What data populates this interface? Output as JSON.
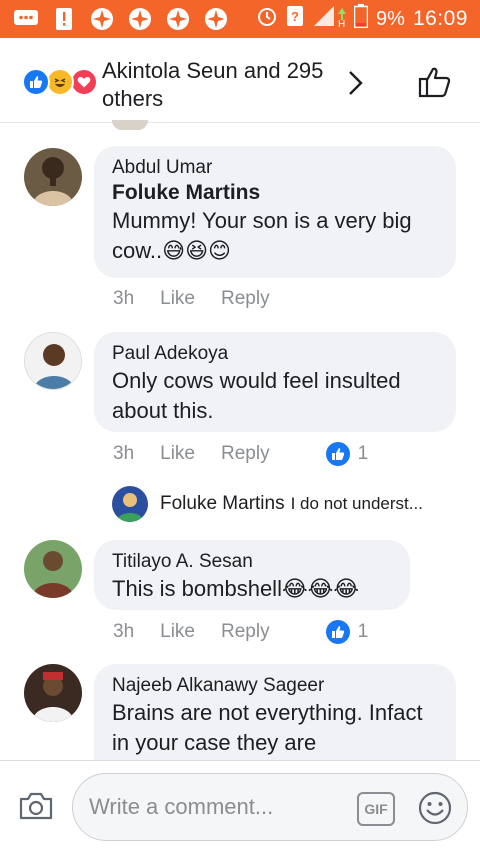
{
  "status_bar": {
    "battery": "9%",
    "time": "16:09",
    "network": "H"
  },
  "header": {
    "reactions_text": "Akintola Seun and 295 others",
    "reaction_icons": [
      "like-icon",
      "haha-icon",
      "love-icon"
    ]
  },
  "comments": [
    {
      "author": "Abdul Umar",
      "mention": "Foluke Martins",
      "text": "Mummy! Your son is a very big cow..",
      "emojis": "😅😆😊",
      "time": "3h",
      "like_label": "Like",
      "reply_label": "Reply",
      "likes": ""
    },
    {
      "author": "Paul Adekoya",
      "text": "Only cows would feel insulted about this.",
      "time": "3h",
      "like_label": "Like",
      "reply_label": "Reply",
      "likes": "1",
      "reply": {
        "author": "Foluke Martins",
        "snippet": "I do not underst..."
      }
    },
    {
      "author": "Titilayo A. Sesan",
      "text": "This is bombshell",
      "emojis": "😂😂😂",
      "time": "3h",
      "like_label": "Like",
      "reply_label": "Reply",
      "likes": "1"
    },
    {
      "author": "Najeeb Alkanawy Sageer",
      "text": "Brains are not everything. Infact in your case they are"
    }
  ],
  "composer": {
    "placeholder": "Write a comment...",
    "gif_label": "GIF"
  },
  "colors": {
    "status_bar": "#f4652a",
    "like_blue": "#1877f2",
    "bubble": "#f0f2f5"
  }
}
